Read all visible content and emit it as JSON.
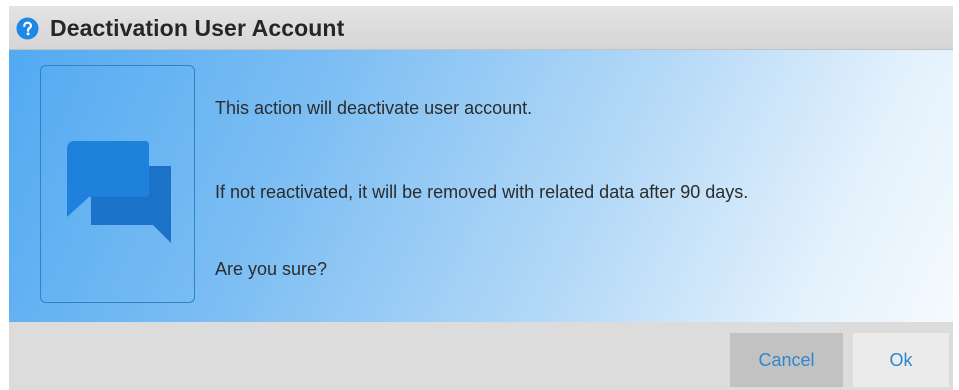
{
  "dialog": {
    "title": "Deactivation User Account",
    "title_icon": "question-circle-icon",
    "content_icon": "chat-bubbles-icon",
    "messages": [
      "This action will deactivate user account.",
      "If not reactivated, it will be removed with related data after 90 days.",
      "Are you sure?"
    ],
    "buttons": {
      "cancel_label": "Cancel",
      "ok_label": "Ok"
    }
  },
  "colors": {
    "accent": "#1e88e5",
    "title_bar": "#dcdcdc",
    "content_gradient_start": "#52aaf2",
    "content_gradient_end": "#f5faff",
    "button_text": "#2f86cf",
    "cancel_button_bg": "#c2c2c2",
    "ok_button_bg": "#ebebeb"
  }
}
